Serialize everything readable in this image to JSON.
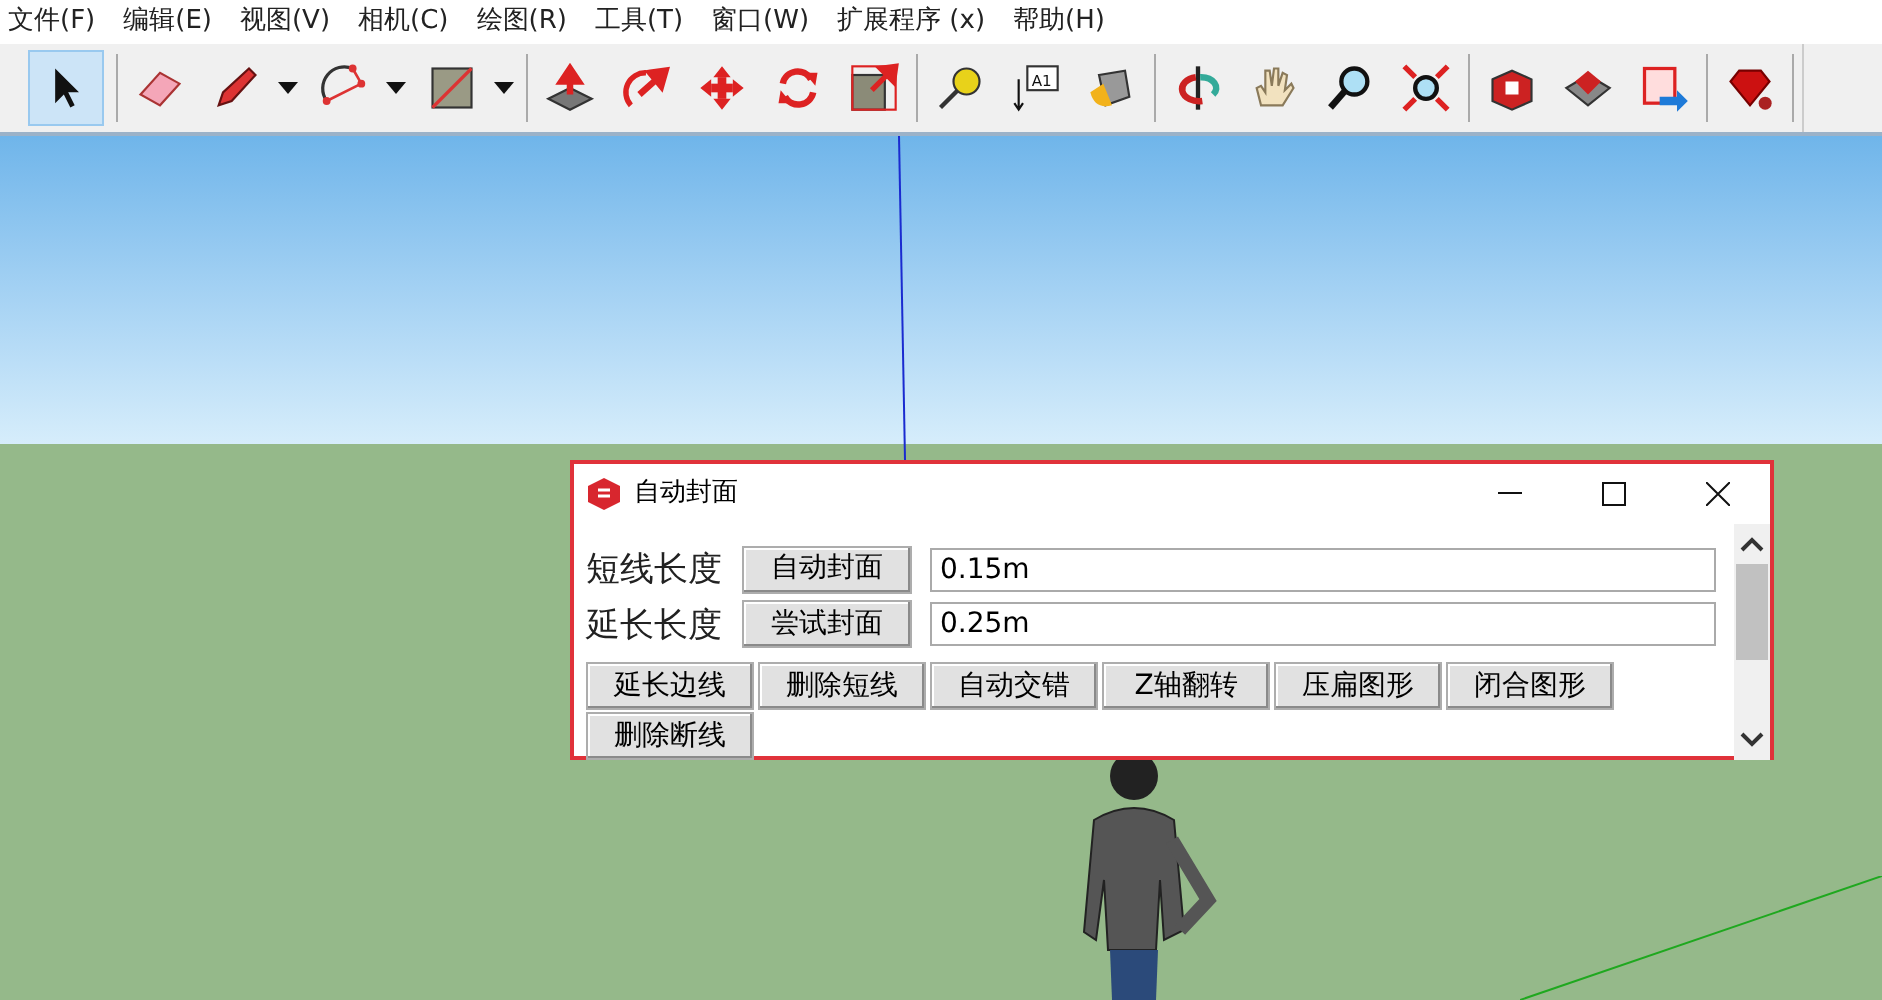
{
  "menu": [
    "文件(F)",
    "编辑(E)",
    "视图(V)",
    "相机(C)",
    "绘图(R)",
    "工具(T)",
    "窗口(W)",
    "扩展程序 (x)",
    "帮助(H)"
  ],
  "toolbar": {
    "groups": [
      [
        {
          "kind": "select",
          "selected": true,
          "dropdown": false
        }
      ],
      [
        {
          "kind": "eraser",
          "selected": false,
          "dropdown": false
        },
        {
          "kind": "pencil",
          "selected": false,
          "dropdown": true
        },
        {
          "kind": "arc",
          "selected": false,
          "dropdown": true
        },
        {
          "kind": "rectangle",
          "selected": false,
          "dropdown": true
        }
      ],
      [
        {
          "kind": "pushpull",
          "selected": false,
          "dropdown": false
        },
        {
          "kind": "followme",
          "selected": false,
          "dropdown": false
        },
        {
          "kind": "move",
          "selected": false,
          "dropdown": false
        },
        {
          "kind": "rotate",
          "selected": false,
          "dropdown": false
        },
        {
          "kind": "scale",
          "selected": false,
          "dropdown": false
        }
      ],
      [
        {
          "kind": "tape",
          "selected": false,
          "dropdown": false
        },
        {
          "kind": "text",
          "selected": false,
          "dropdown": false,
          "label": "A1"
        },
        {
          "kind": "paint",
          "selected": false,
          "dropdown": false
        }
      ],
      [
        {
          "kind": "orbit",
          "selected": false,
          "dropdown": false
        },
        {
          "kind": "pan",
          "selected": false,
          "dropdown": false
        },
        {
          "kind": "zoom",
          "selected": false,
          "dropdown": false
        },
        {
          "kind": "extents",
          "selected": false,
          "dropdown": false
        }
      ],
      [
        {
          "kind": "warehouse",
          "selected": false,
          "dropdown": false
        },
        {
          "kind": "gems",
          "selected": false,
          "dropdown": false
        },
        {
          "kind": "export",
          "selected": false,
          "dropdown": false
        }
      ],
      [
        {
          "kind": "ruby",
          "selected": false,
          "dropdown": false
        }
      ]
    ]
  },
  "dialog": {
    "title": "自动封面",
    "rows": [
      {
        "label": "短线长度",
        "button": "自动封面",
        "value": "0.15m"
      },
      {
        "label": "延长长度",
        "button": "尝试封面",
        "value": "0.25m"
      }
    ],
    "buttons": [
      "延长边线",
      "删除短线",
      "自动交错",
      "Z轴翻转",
      "压扁图形",
      "闭合图形",
      "删除断线"
    ]
  }
}
